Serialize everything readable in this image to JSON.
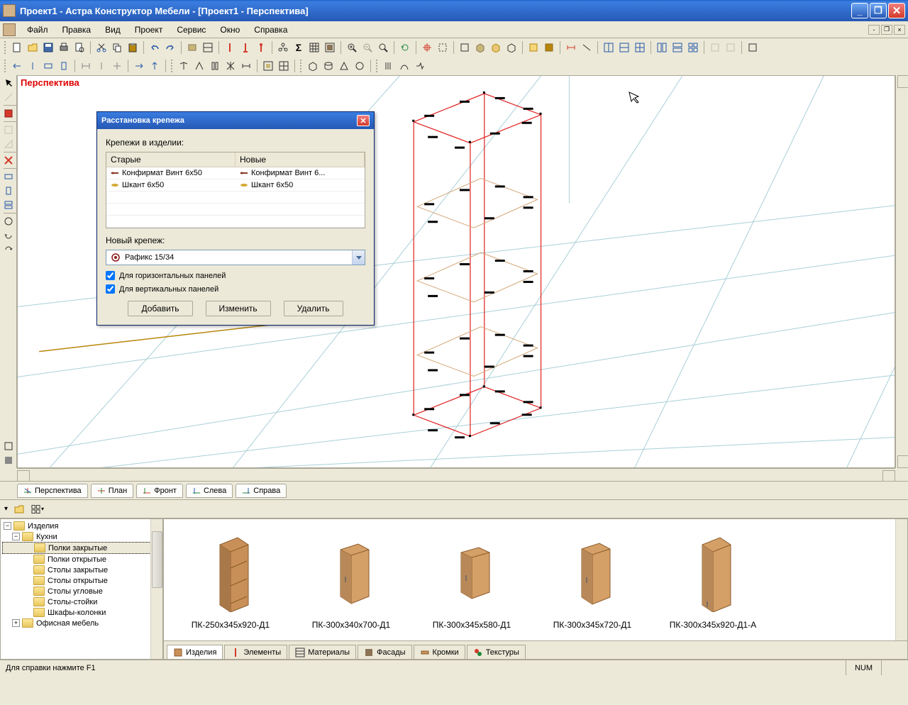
{
  "titlebar": {
    "text": "Проект1 - Астра Конструктор Мебели - [Проект1 - Перспектива]"
  },
  "menu": {
    "items": [
      "Файл",
      "Правка",
      "Вид",
      "Проект",
      "Сервис",
      "Окно",
      "Справка"
    ]
  },
  "viewport": {
    "label": "Перспектива"
  },
  "view_tabs": [
    "Перспектива",
    "План",
    "Фронт",
    "Слева",
    "Справа"
  ],
  "tree": {
    "root": "Изделия",
    "node1": "Кухни",
    "children": [
      "Полки закрытые",
      "Полки открытые",
      "Столы закрытые",
      "Столы открытые",
      "Столы угловые",
      "Столы-стойки",
      "Шкафы-колонки"
    ],
    "node2": "Офисная мебель"
  },
  "catalog": {
    "items": [
      "ПК-250х345х920-Д1",
      "ПК-300х340х700-Д1",
      "ПК-300х345х580-Д1",
      "ПК-300х345х720-Д1",
      "ПК-300х345х920-Д1-А"
    ]
  },
  "lib_tabs": [
    "Изделия",
    "Элементы",
    "Материалы",
    "Фасады",
    "Кромки",
    "Текстуры"
  ],
  "dialog": {
    "title": "Расстановка крепежа",
    "section1": "Крепежи в изделии:",
    "col_old": "Старые",
    "col_new": "Новые",
    "row1_old": "Конфирмат Винт 6x50",
    "row1_new": "Конфирмат Винт 6...",
    "row2_old": "Шкант 6x50",
    "row2_new": "Шкант 6x50",
    "section2": "Новый крепеж:",
    "combo_val": "Рафикс 15/34",
    "check1": "Для горизонтальных панелей",
    "check2": "Для вертикальных панелей",
    "btn_add": "Добавить",
    "btn_edit": "Изменить",
    "btn_del": "Удалить"
  },
  "status": {
    "help": "Для справки нажмите F1",
    "num": "NUM"
  }
}
